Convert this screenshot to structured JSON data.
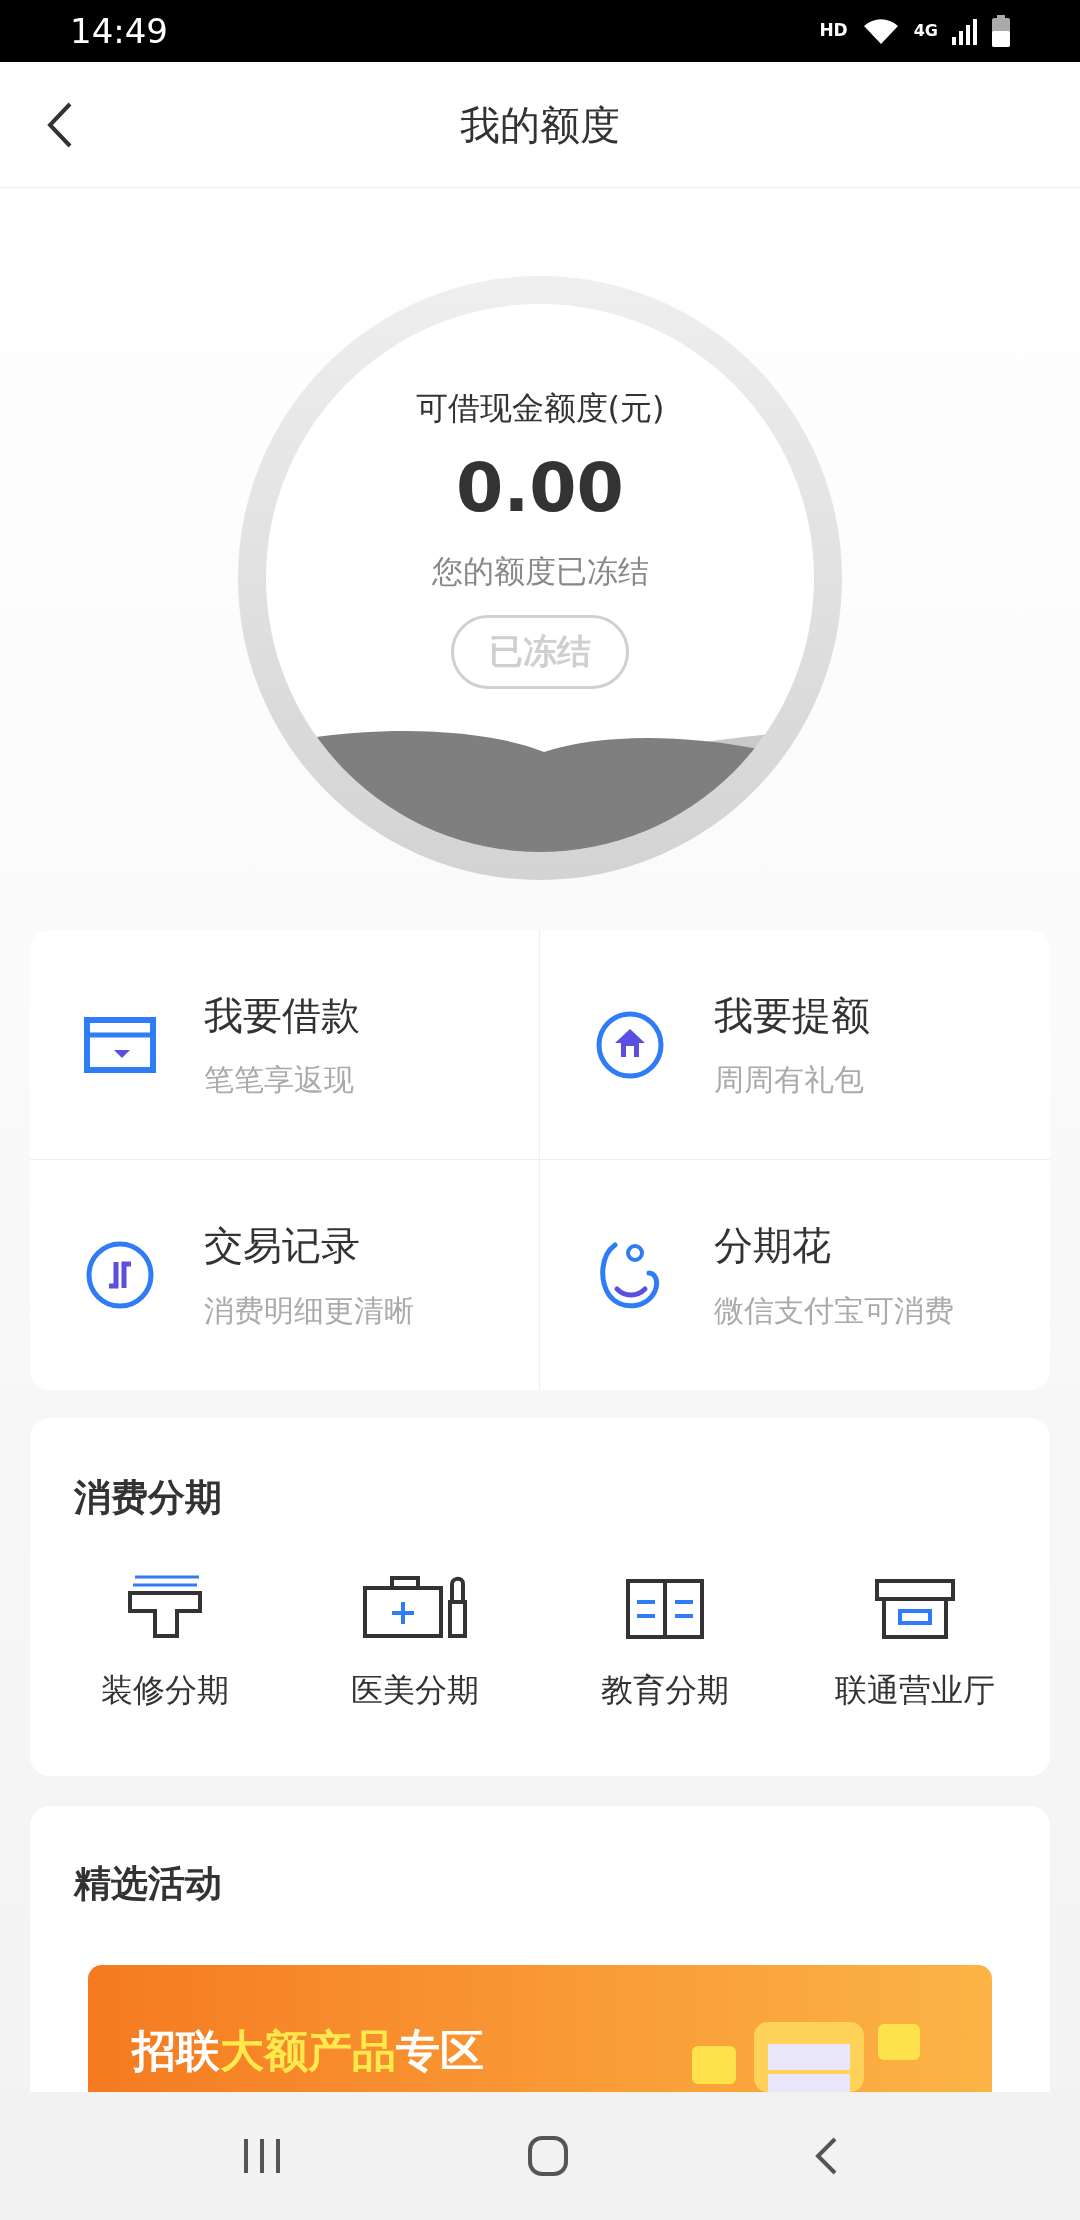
{
  "status_bar": {
    "time": "14:49",
    "indicators": [
      "HD",
      "4G"
    ]
  },
  "header": {
    "title": "我的额度"
  },
  "quota": {
    "label": "可借现金额度(元)",
    "amount": "0.00",
    "note": "您的额度已冻结",
    "button": {
      "label": "已冻结",
      "disabled": true
    }
  },
  "menu": [
    {
      "kind": "loan",
      "title": "我要借款",
      "subtitle": "笔笔享返现"
    },
    {
      "kind": "raise",
      "title": "我要提额",
      "subtitle": "周周有礼包"
    },
    {
      "kind": "records",
      "title": "交易记录",
      "subtitle": "消费明细更清晰"
    },
    {
      "kind": "flower",
      "title": "分期花",
      "subtitle": "微信支付宝可消费"
    }
  ],
  "installments": {
    "title": "消费分期",
    "items": [
      {
        "kind": "decor",
        "label": "装修分期"
      },
      {
        "kind": "beauty",
        "label": "医美分期"
      },
      {
        "kind": "education",
        "label": "教育分期"
      },
      {
        "kind": "store",
        "label": "联通营业厅"
      }
    ]
  },
  "activities": {
    "title": "精选活动",
    "banner": {
      "segments": [
        {
          "text": "招联",
          "highlight": false
        },
        {
          "text": "大额产品",
          "highlight": true
        },
        {
          "text": "专区",
          "highlight": false
        }
      ]
    }
  }
}
